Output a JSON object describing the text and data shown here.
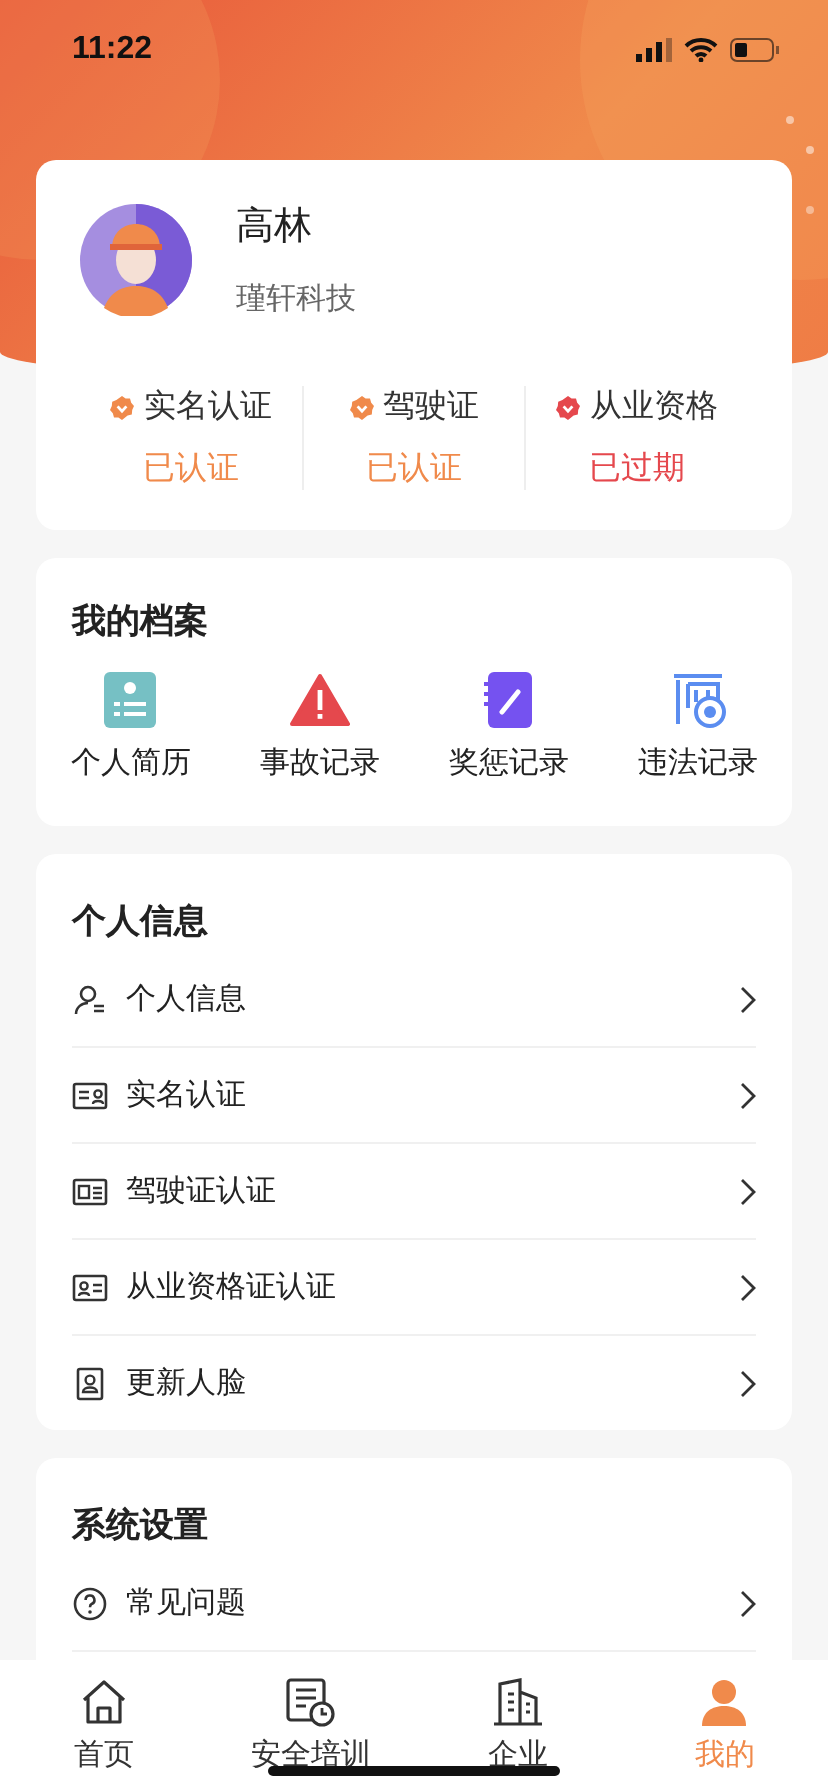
{
  "status_bar": {
    "time": "11:22"
  },
  "profile": {
    "name": "高林",
    "company": "瑾轩科技",
    "certifications": [
      {
        "label": "实名认证",
        "status": "已认证",
        "kind": "valid"
      },
      {
        "label": "驾驶证",
        "status": "已认证",
        "kind": "valid"
      },
      {
        "label": "从业资格",
        "status": "已过期",
        "kind": "expired"
      }
    ]
  },
  "archive": {
    "title": "我的档案",
    "items": [
      "个人简历",
      "事故记录",
      "奖惩记录",
      "违法记录"
    ]
  },
  "personal_info": {
    "title": "个人信息",
    "items": [
      "个人信息",
      "实名认证",
      "驾驶证认证",
      "从业资格证认证",
      "更新人脸"
    ]
  },
  "settings": {
    "title": "系统设置",
    "items": [
      "常见问题"
    ]
  },
  "tab_bar": [
    {
      "label": "首页",
      "selected": false
    },
    {
      "label": "安全培训",
      "selected": false
    },
    {
      "label": "企业",
      "selected": false
    },
    {
      "label": "我的",
      "selected": true
    }
  ]
}
